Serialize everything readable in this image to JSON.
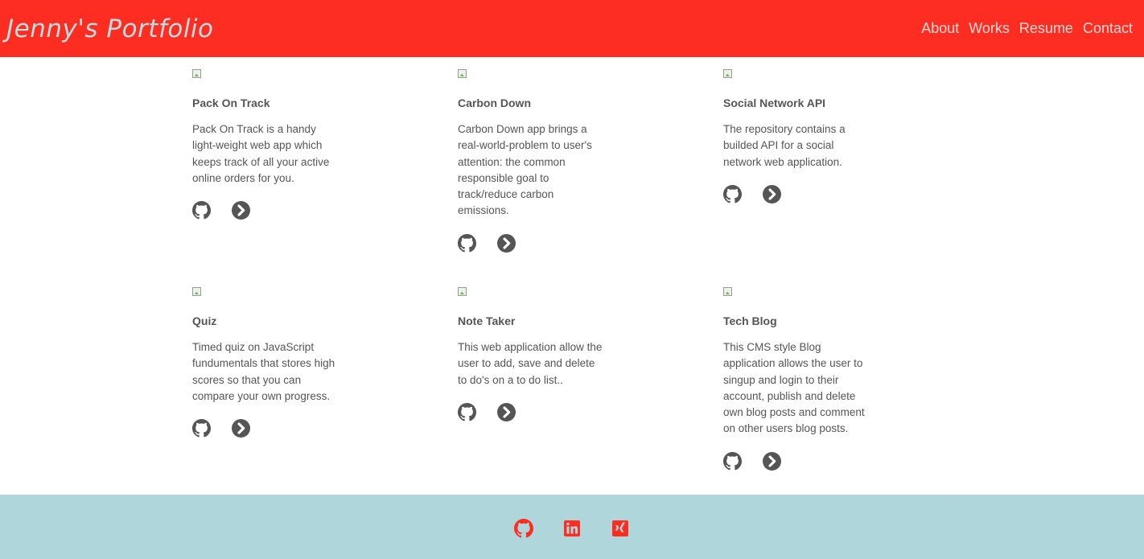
{
  "header": {
    "brand": "Jenny's Portfolio",
    "nav": [
      "About",
      "Works",
      "Resume",
      "Contact"
    ]
  },
  "projects": [
    {
      "title": "Pack On Track",
      "description": "Pack On Track is a handy light-weight web app which keeps track of all your active online orders for you."
    },
    {
      "title": "Carbon Down",
      "description": "Carbon Down app brings a real-world-problem to user's attention: the common responsible goal to track/reduce carbon emissions."
    },
    {
      "title": "Social Network API",
      "description": "The repository contains a builded API for a social network web application."
    },
    {
      "title": "Quiz",
      "description": "Timed quiz on JavaScript fundumentals that stores high scores so that you can compare your own progress."
    },
    {
      "title": "Note Taker",
      "description": "This web application allow the user to add, save and delete to do's on a to do list.."
    },
    {
      "title": "Tech Blog",
      "description": "This CMS style Blog application allows the user to singup and login to their account, publish and delete own blog posts and comment on other users blog posts."
    }
  ],
  "icons": {
    "card_actions": [
      "github-icon",
      "arrow-circle-right-icon"
    ],
    "footer": [
      "github-icon",
      "linkedin-icon",
      "xing-icon"
    ]
  },
  "colors": {
    "header_bg": "#fe2d21",
    "brand_text": "#b5dde0",
    "footer_bg": "#aed6db",
    "footer_icons": "#fe2d21",
    "action_icons": "#555555"
  }
}
